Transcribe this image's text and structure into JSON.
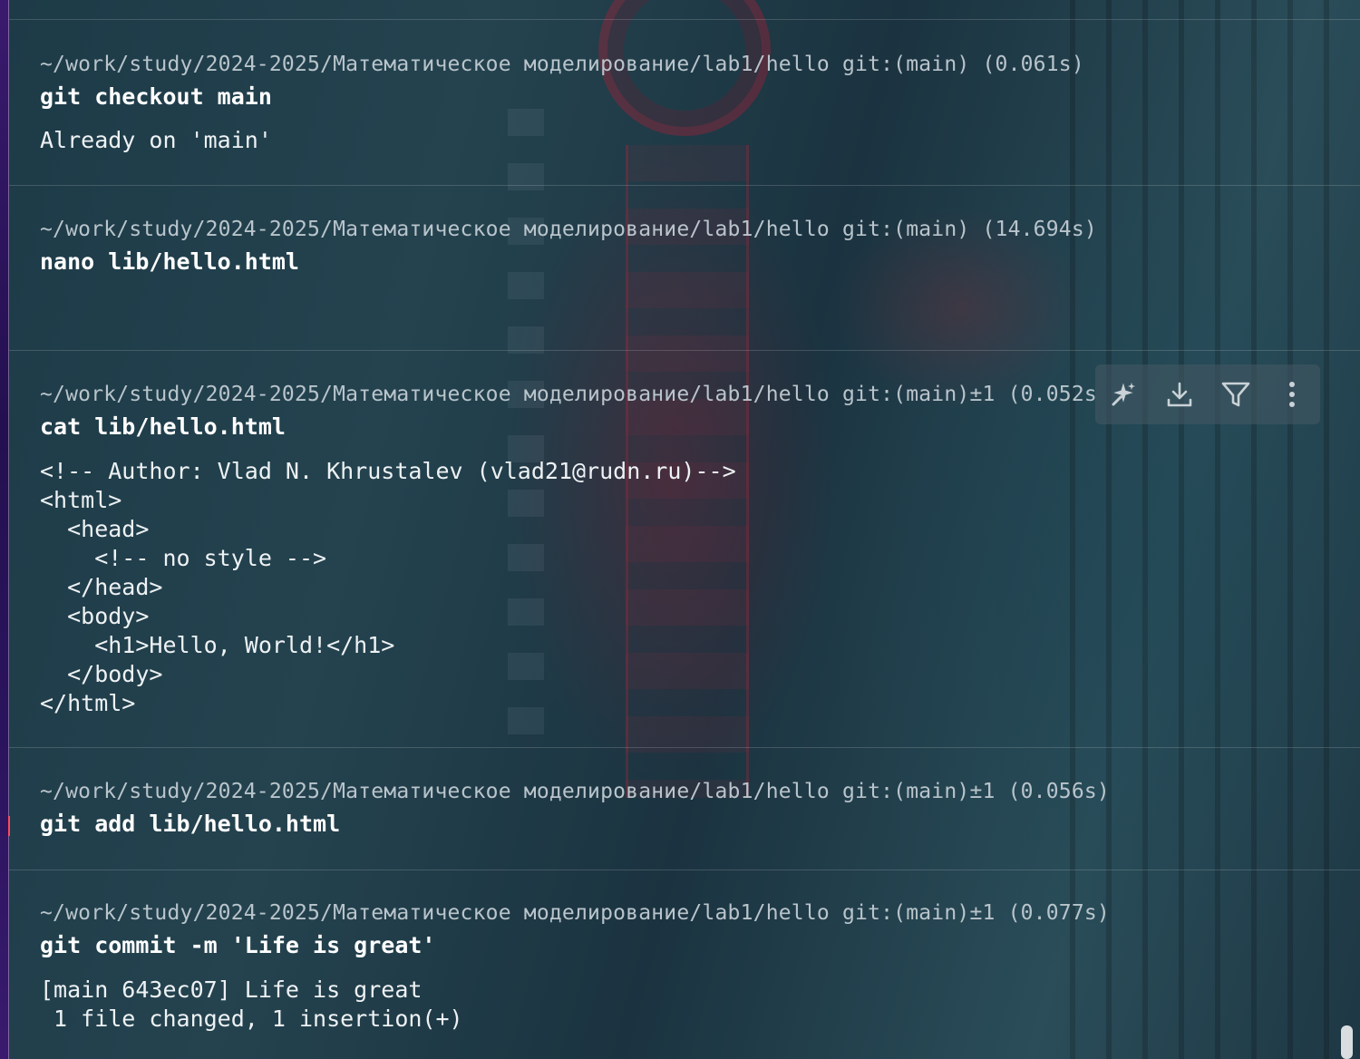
{
  "terminal": {
    "blocks": [
      {
        "prompt": "~/work/study/2024-2025/Математическое моделирование/lab1/hello git:(main) (0.061s)",
        "command": "git checkout main",
        "output": "Already on 'main'"
      },
      {
        "prompt": "~/work/study/2024-2025/Математическое моделирование/lab1/hello git:(main) (14.694s)",
        "command": "nano lib/hello.html",
        "output": ""
      },
      {
        "prompt": "~/work/study/2024-2025/Математическое моделирование/lab1/hello git:(main)±1 (0.052s",
        "command": "cat lib/hello.html",
        "output": "<!-- Author: Vlad N. Khrustalev (vlad21@rudn.ru)-->\n<html>\n  <head>\n    <!-- no style -->\n  </head>\n  <body>\n    <h1>Hello, World!</h1>\n  </body>\n</html>"
      },
      {
        "prompt": "~/work/study/2024-2025/Математическое моделирование/lab1/hello git:(main)±1 (0.056s)",
        "command": "git add lib/hello.html",
        "output": ""
      },
      {
        "prompt": "~/work/study/2024-2025/Математическое моделирование/lab1/hello git:(main)±1 (0.077s)",
        "command": "git commit -m 'Life is great'",
        "output": "[main 643ec07] Life is great\n 1 file changed, 1 insertion(+)"
      }
    ]
  },
  "block_toolbar": {
    "icons": [
      "ai-sparkle-icon",
      "download-icon",
      "filter-icon",
      "more-vertical-icon"
    ]
  },
  "colors": {
    "background": "#1f3d49",
    "prompt_text": "#b9c4cb",
    "command_text": "#ffffff",
    "divider": "rgba(255,255,255,0.16)",
    "left_accent": "#2b145e"
  }
}
